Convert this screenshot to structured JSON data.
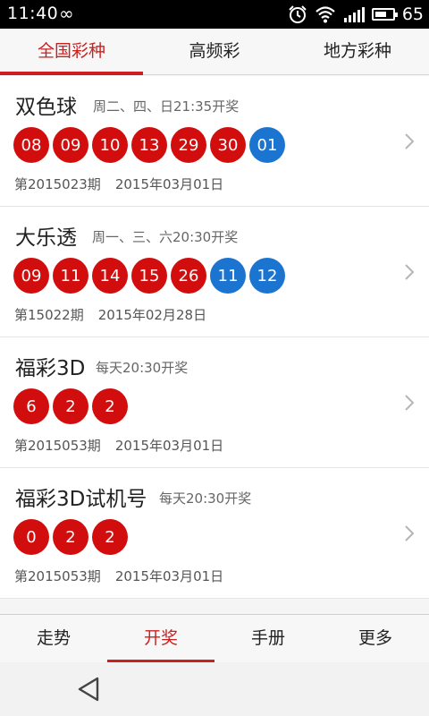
{
  "status_bar": {
    "time": "11:40",
    "infinity_symbol": "∞",
    "battery": "65",
    "battery_level": 0.65
  },
  "top_tabs": [
    {
      "label": "全国彩种",
      "active": true
    },
    {
      "label": "高频彩",
      "active": false
    },
    {
      "label": "地方彩种",
      "active": false
    }
  ],
  "lotteries": [
    {
      "name": "双色球",
      "schedule": "周二、四、日21:35开奖",
      "red_balls": [
        "08",
        "09",
        "10",
        "13",
        "29",
        "30"
      ],
      "blue_balls": [
        "01"
      ],
      "issue": "第2015023期",
      "date": "2015年03月01日"
    },
    {
      "name": "大乐透",
      "schedule": "周一、三、六20:30开奖",
      "red_balls": [
        "09",
        "11",
        "14",
        "15",
        "26"
      ],
      "blue_balls": [
        "11",
        "12"
      ],
      "issue": "第15022期",
      "date": "2015年02月28日"
    },
    {
      "name": "福彩3D",
      "schedule": "每天20:30开奖",
      "red_balls": [
        "6",
        "2",
        "2"
      ],
      "blue_balls": [],
      "issue": "第2015053期",
      "date": "2015年03月01日"
    },
    {
      "name": "福彩3D试机号",
      "schedule": "每天20:30开奖",
      "red_balls": [
        "0",
        "2",
        "2"
      ],
      "blue_balls": [],
      "issue": "第2015053期",
      "date": "2015年03月01日"
    }
  ],
  "bottom_tabs": [
    {
      "label": "走势",
      "active": false
    },
    {
      "label": "开奖",
      "active": true
    },
    {
      "label": "手册",
      "active": false
    },
    {
      "label": "更多",
      "active": false
    }
  ],
  "colors": {
    "accent": "#cc1f1f",
    "red_ball": "#d20d0d",
    "blue_ball": "#1b74d0"
  },
  "icons": {
    "alarm": "alarm-icon",
    "wifi": "wifi-icon",
    "signal": "signal-icon",
    "battery": "battery-icon",
    "row_arrow": "chevron-right-icon",
    "back": "back-triangle-icon"
  }
}
